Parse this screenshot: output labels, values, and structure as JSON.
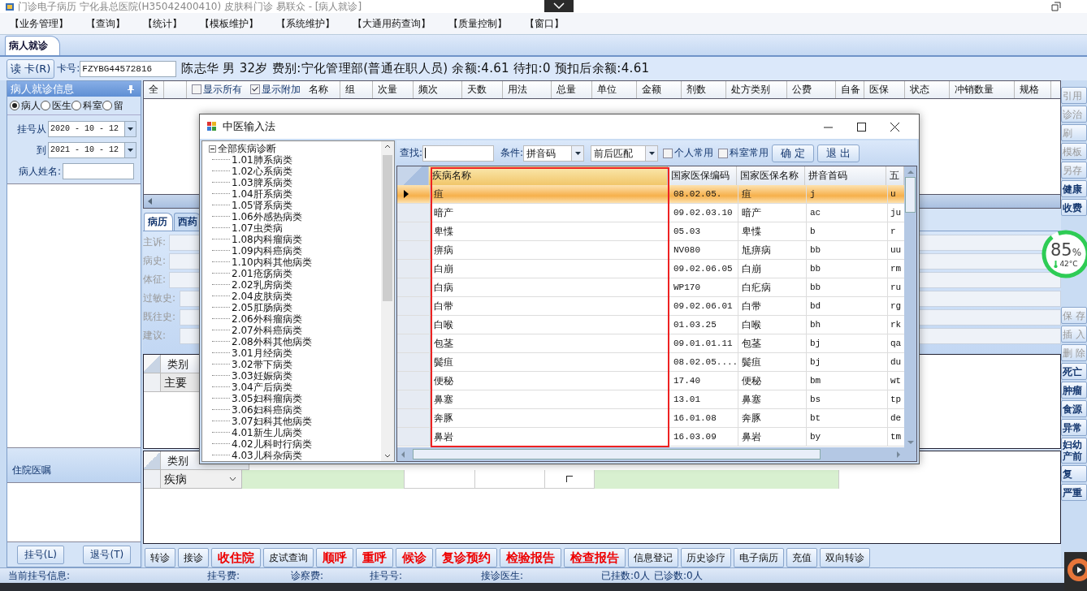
{
  "window": {
    "title": "门诊电子病历  宁化县总医院(H35042400410)  皮肤科门诊  易联众 - [病人就诊]"
  },
  "menu": [
    "【业务管理】",
    "【查询】",
    "【统计】",
    "【模板维护】",
    "【系统维护】",
    "【大通用药查询】",
    "【质量控制】",
    "【窗口】"
  ],
  "doc_tab": {
    "label": "病人就诊",
    "selected": true
  },
  "patient_bar": {
    "read_button": "读 卡(R)",
    "card_label": "卡号:",
    "card_no": "FZYBG44572816",
    "info": "陈志华 男 32岁 费别:宁化管理部(普通在职人员) 余额:4.61 待扣:0 预扣后余额:4.61"
  },
  "left_panel": {
    "title": "病人就诊信息",
    "filters": [
      {
        "label": "病人",
        "selected": true
      },
      {
        "label": "医生",
        "selected": false
      },
      {
        "label": "科室",
        "selected": false
      },
      {
        "label": "留",
        "selected": false
      }
    ],
    "date_from_label": "挂号从",
    "date_from": "2020 - 10 - 12",
    "date_to_label": "到",
    "date_to": "2021 - 10 - 12",
    "name_label": "病人姓名:",
    "orders_title": "住院医嘱",
    "buttons": [
      "挂号(L)",
      "退号(T)"
    ]
  },
  "rx_grid": {
    "select_all": "全",
    "show_all": {
      "label": "显示所有",
      "checked": false
    },
    "show_extra": {
      "label": "显示附加",
      "checked": true
    },
    "columns": [
      "名称",
      "组",
      "次量",
      "频次",
      "天数",
      "用法",
      "总量",
      "单位",
      "金额",
      "剂数",
      "处方类别",
      "公费",
      "自备",
      "医保",
      "状态",
      "冲销数量",
      "规格"
    ]
  },
  "record_tabs": [
    {
      "label": "病历",
      "selected": true
    },
    {
      "label": "西药",
      "selected": false
    }
  ],
  "record_fields": [
    "主诉:",
    "病史:",
    "体征:",
    "过敏史:",
    "既往史:",
    "建议:"
  ],
  "diagnosis_grid": {
    "column": "类别",
    "rows": [
      "主要"
    ]
  },
  "tcm_grid": {
    "column": "类别",
    "value": "疾病",
    "flag_checked": false
  },
  "actions": [
    {
      "label": "转诊",
      "emphasis": false
    },
    {
      "label": "接诊",
      "emphasis": false
    },
    {
      "label": "收住院",
      "emphasis": true
    },
    {
      "label": "皮试查询",
      "emphasis": false
    },
    {
      "label": "顺呼",
      "emphasis": true
    },
    {
      "label": "重呼",
      "emphasis": true
    },
    {
      "label": "候诊",
      "emphasis": true
    },
    {
      "label": "复诊预约",
      "emphasis": true
    },
    {
      "label": "检验报告",
      "emphasis": true
    },
    {
      "label": "检查报告",
      "emphasis": true
    },
    {
      "label": "信息登记",
      "emphasis": false
    },
    {
      "label": "历史诊疗",
      "emphasis": false
    },
    {
      "label": "电子病历",
      "emphasis": false
    },
    {
      "label": "充值",
      "emphasis": false
    },
    {
      "label": "双向转诊",
      "emphasis": false
    }
  ],
  "side_buttons_top": [
    {
      "label": "引用",
      "disabled": true
    },
    {
      "label": "诊治",
      "disabled": true
    },
    {
      "label": "刷",
      "disabled": true
    },
    {
      "label": "模板",
      "disabled": true
    },
    {
      "label": "另存",
      "disabled": true
    },
    {
      "label": "健康",
      "disabled": false
    },
    {
      "label": "收费",
      "disabled": false
    }
  ],
  "side_buttons_bottom": [
    {
      "label": "保 存",
      "disabled": true
    },
    {
      "label": "插 入",
      "disabled": true
    },
    {
      "label": "删 除",
      "disabled": true
    },
    {
      "label": "死亡",
      "disabled": false
    },
    {
      "label": "肿瘤",
      "disabled": false
    },
    {
      "label": "食源",
      "disabled": false
    },
    {
      "label": "异常",
      "disabled": false
    },
    {
      "label": "妇幼产前",
      "disabled": false
    },
    {
      "label": "复",
      "disabled": false
    },
    {
      "label": "严重",
      "disabled": false
    }
  ],
  "status_bar": [
    "当前挂号信息:",
    "挂号费:",
    "诊察费:",
    "挂号号:",
    "接诊医生:",
    "已挂数:0人",
    "已诊数:0人"
  ],
  "monitor_widget": {
    "value": "85",
    "unit": "%",
    "temperature": "42°C"
  },
  "dialog": {
    "title": "中医输入法",
    "tree": {
      "label": "全部疾病诊断",
      "expanded": true,
      "children": [
        {
          "label": "1.01肺系病类"
        },
        {
          "label": "1.02心系病类"
        },
        {
          "label": "1.03脾系病类"
        },
        {
          "label": "1.04肝系病类"
        },
        {
          "label": "1.05肾系病类"
        },
        {
          "label": "1.06外感热病类"
        },
        {
          "label": "1.07虫类病"
        },
        {
          "label": "1.08内科瘤病类"
        },
        {
          "label": "1.09内科癌病类"
        },
        {
          "label": "1.10内科其他病类"
        },
        {
          "label": "2.01疮疡病类"
        },
        {
          "label": "2.02乳房病类"
        },
        {
          "label": "2.04皮肤病类"
        },
        {
          "label": "2.05肛肠病类"
        },
        {
          "label": "2.06外科瘤病类"
        },
        {
          "label": "2.07外科癌病类"
        },
        {
          "label": "2.08外科其他病类"
        },
        {
          "label": "3.01月经病类"
        },
        {
          "label": "3.02带下病类"
        },
        {
          "label": "3.03妊娠病类"
        },
        {
          "label": "3.04产后病类"
        },
        {
          "label": "3.05妇科瘤病类"
        },
        {
          "label": "3.06妇科癌病类"
        },
        {
          "label": "3.07妇科其他病类"
        },
        {
          "label": "4.01新生儿病类"
        },
        {
          "label": "4.02儿科时行病类"
        },
        {
          "label": "4.03儿科杂病类"
        }
      ]
    },
    "search_label": "查找:",
    "condition_label": "条件:",
    "condition": "拼音码",
    "match": "前后匹配",
    "options": [
      {
        "label": "个人常用",
        "checked": false
      },
      {
        "label": "科室常用",
        "checked": false
      }
    ],
    "buttons": [
      "确 定",
      "退 出"
    ],
    "columns": [
      {
        "label": "疾病名称",
        "marked": true
      },
      {
        "label": "国家医保编码",
        "marked": false
      },
      {
        "label": "国家医保名称",
        "marked": false
      },
      {
        "label": "拼音首码",
        "marked": false
      },
      {
        "label": "五",
        "marked": false
      }
    ],
    "rows": [
      {
        "cells": [
          "疽",
          "08.02.05.",
          "疽",
          "j",
          "u"
        ],
        "selected": true
      },
      {
        "cells": [
          "暗产",
          "09.02.03.10",
          "暗产",
          "ac",
          "ju"
        ],
        "selected": false
      },
      {
        "cells": [
          "卑惵",
          "05.03",
          "卑惵",
          "b",
          "r"
        ],
        "selected": false
      },
      {
        "cells": [
          "痹病",
          "NV080",
          "尪痹病",
          "bb",
          "uu"
        ],
        "selected": false
      },
      {
        "cells": [
          "白崩",
          "09.02.06.05",
          "白崩",
          "bb",
          "rm"
        ],
        "selected": false
      },
      {
        "cells": [
          "白病",
          "WP170",
          "白疕病",
          "bb",
          "ru"
        ],
        "selected": false
      },
      {
        "cells": [
          "白带",
          "09.02.06.01",
          "白带",
          "bd",
          "rg"
        ],
        "selected": false
      },
      {
        "cells": [
          "白喉",
          "01.03.25",
          "白喉",
          "bh",
          "rk"
        ],
        "selected": false
      },
      {
        "cells": [
          "包茎",
          "09.01.01.11",
          "包茎",
          "bj",
          "qa"
        ],
        "selected": false
      },
      {
        "cells": [
          "鬓疽",
          "08.02.05....",
          "鬓疽",
          "bj",
          "du"
        ],
        "selected": false
      },
      {
        "cells": [
          "便秘",
          "17.40",
          "便秘",
          "bm",
          "wt"
        ],
        "selected": false
      },
      {
        "cells": [
          "鼻塞",
          "13.01",
          "鼻塞",
          "bs",
          "tp"
        ],
        "selected": false
      },
      {
        "cells": [
          "奔豚",
          "16.01.08",
          "奔豚",
          "bt",
          "de"
        ],
        "selected": false
      },
      {
        "cells": [
          "鼻岩",
          "16.03.09",
          "鼻岩",
          "by",
          "tm"
        ],
        "selected": false
      }
    ]
  }
}
